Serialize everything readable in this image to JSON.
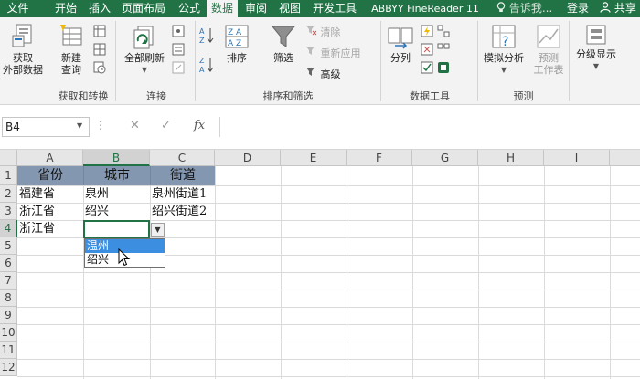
{
  "tabs": [
    {
      "label": "文件",
      "active": false
    },
    {
      "label": "开始",
      "active": false
    },
    {
      "label": "插入",
      "active": false
    },
    {
      "label": "页面布局",
      "active": false
    },
    {
      "label": "公式",
      "active": false
    },
    {
      "label": "数据",
      "active": true
    },
    {
      "label": "审阅",
      "active": false
    },
    {
      "label": "视图",
      "active": false
    },
    {
      "label": "开发工具",
      "active": false
    },
    {
      "label": "ABBYY FineReader 11",
      "active": false
    }
  ],
  "tell_me": "告诉我...",
  "login": "登录",
  "share": "共享",
  "ribbon": {
    "get_external_data": "获取\n外部数据",
    "new_query": "新建\n查询",
    "group_get_transform": "获取和转换",
    "refresh_all": "全部刷新",
    "group_connections": "连接",
    "sort": "排序",
    "filter": "筛选",
    "clear": "清除",
    "reapply": "重新应用",
    "advanced": "高级",
    "group_sort_filter": "排序和筛选",
    "text_to_columns": "分列",
    "group_data_tools": "数据工具",
    "what_if": "模拟分析",
    "forecast_sheet": "预测\n工作表",
    "group_forecast": "预测",
    "outline": "分级显示"
  },
  "formula_bar": {
    "name_box": "B4",
    "cancel": "✕",
    "enter": "✓",
    "fx": "fx",
    "content": ""
  },
  "columns": [
    "A",
    "B",
    "C",
    "D",
    "E",
    "F",
    "G",
    "H",
    "I"
  ],
  "selected_column": "B",
  "rows": [
    "1",
    "2",
    "3",
    "4",
    "5",
    "6",
    "7",
    "8",
    "9",
    "10",
    "11",
    "12"
  ],
  "selected_row": "4",
  "cells": {
    "A1": "省份",
    "B1": "城市",
    "C1": "街道",
    "A2": "福建省",
    "B2": "泉州",
    "C2": "泉州街道1",
    "A3": "浙江省",
    "B3": "绍兴",
    "C3": "绍兴街道2",
    "A4": "浙江省"
  },
  "dropdown": {
    "options": [
      "温州",
      "绍兴"
    ],
    "highlighted_index": 0
  },
  "colors": {
    "accent": "#217346",
    "header_fill": "#8497b0",
    "dropdown_highlight": "#3c8fe0"
  }
}
